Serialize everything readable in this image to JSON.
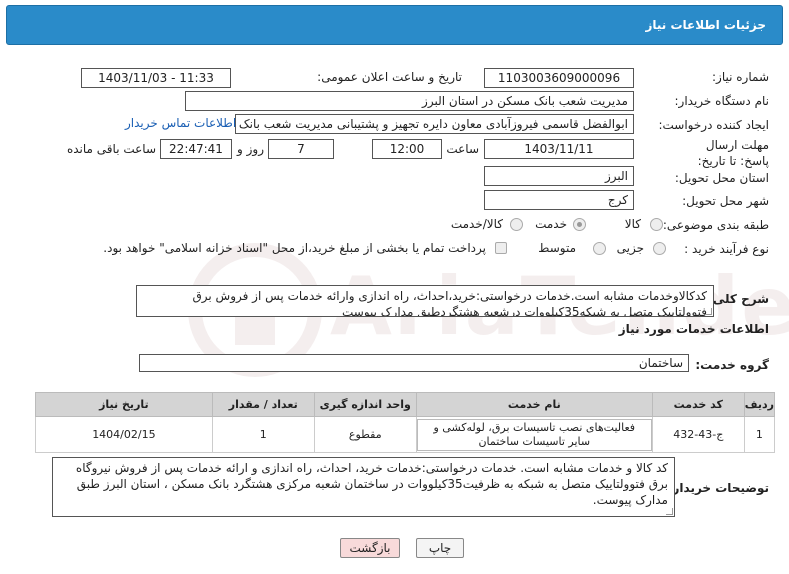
{
  "header": {
    "title": "جزئیات اطلاعات نیاز"
  },
  "form": {
    "need_number_label": "شماره نیاز:",
    "need_number": "1103003609000096",
    "announce_label": "تاریخ و ساعت اعلان عمومی:",
    "announce_value": "1403/11/03 - 11:33",
    "buyer_org_label": "نام دستگاه خریدار:",
    "buyer_org": "مدیریت شعب بانک مسکن در استان البرز",
    "creator_label": "ایجاد کننده درخواست:",
    "creator": "ابوالفضل قاسمی فیروزآبادی معاون دایره تجهیز و پشتیبانی مدیریت شعب بانک م",
    "contact_link": "اطلاعات تماس خریدار",
    "deadline_label": "مهلت ارسال پاسخ: تا تاریخ:",
    "deadline_date": "1403/11/11",
    "time_label": "ساعت",
    "deadline_time": "12:00",
    "days_value": "7",
    "days_label": "روز و",
    "remaining_time": "22:47:41",
    "remaining_label": "ساعت باقی مانده",
    "province_label": "استان محل تحویل:",
    "province": "البرز",
    "city_label": "شهر محل تحویل:",
    "city": "کرج",
    "category_label": "طبقه بندی موضوعی:",
    "category_options": [
      "کالا",
      "خدمت",
      "کالا/خدمت"
    ],
    "process_label": "نوع فرآیند خرید :",
    "process_options": [
      "جزیی",
      "متوسط"
    ],
    "payment_note": "پرداخت تمام یا بخشی از مبلغ خرید،از محل \"اسناد خزانه اسلامی\" خواهد بود."
  },
  "summary": {
    "label": "شرح کلی نیاز:",
    "text": "کدکالاوخدمات مشابه است.خدمات درخواستی:خرید،احداث، راه اندازی وارائه خدمات پس از فروش برق فتوولتاییک متصل به شبکه35کیلووات درشعبه هشتگردطبق مدارک پیوست"
  },
  "services": {
    "section_title": "اطلاعات خدمات مورد نیاز",
    "group_label": "گروه خدمت:",
    "group_value": "ساختمان",
    "columns": [
      "ردیف",
      "کد خدمت",
      "نام خدمت",
      "واحد اندازه گیری",
      "تعداد / مقدار",
      "تاریخ نیاز"
    ],
    "rows": [
      {
        "row": "1",
        "code": "ج-43-432",
        "name": "فعالیت‌های نصب تاسیسات برق، لوله‌کشی و سایر تاسیسات ساختمان",
        "unit": "مقطوع",
        "qty": "1",
        "date": "1404/02/15"
      }
    ]
  },
  "buyer_notes": {
    "label": "توضیحات خریدار:",
    "text": "کد کالا و خدمات مشابه است. خدمات درخواستی:خدمات خرید، احداث، راه اندازی و ارائه خدمات پس از فروش نیروگاه برق فتوولتاییک متصل به شبکه به ظرفیت35کیلووات در ساختمان شعبه مرکزی هشتگرد بانک مسکن ، استان البرز طبق مدارک پیوست."
  },
  "buttons": {
    "print": "چاپ",
    "back": "بازگشت"
  },
  "watermark": "AriaTender.neT",
  "colors": {
    "header": "#2a8bc9",
    "link": "#1a5fb4",
    "back_button": "#f8dada"
  }
}
